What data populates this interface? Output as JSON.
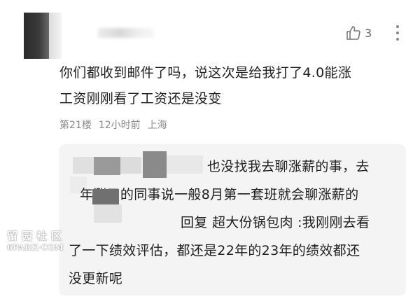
{
  "comment": {
    "like_count": "3",
    "lines": [
      "你们都收到邮件了吗，说这次是给我打了4.0能涨",
      "工资刚刚看了工资还是没变"
    ],
    "floor": "第21楼",
    "time": "12小时前",
    "location": "上海"
  },
  "reply": {
    "lines": [
      "也没找我去聊涨薪的事，去",
      "年涨了的同事说一般8月第一套班就会聊涨薪的",
      "回复 超大份锅包肉 :我刚刚去看",
      "了一下绩效评估，都还是22年的23年的绩效都还",
      "没更新呢"
    ]
  },
  "watermark": {
    "cn": "留园社区",
    "en": "6PARK·COM"
  },
  "icons": {
    "like": "thumbs-up-icon",
    "more": "more-vertical-icon"
  },
  "colors": {
    "reply_background": "#f4f4f4",
    "meta_text": "#8a8a8a"
  }
}
